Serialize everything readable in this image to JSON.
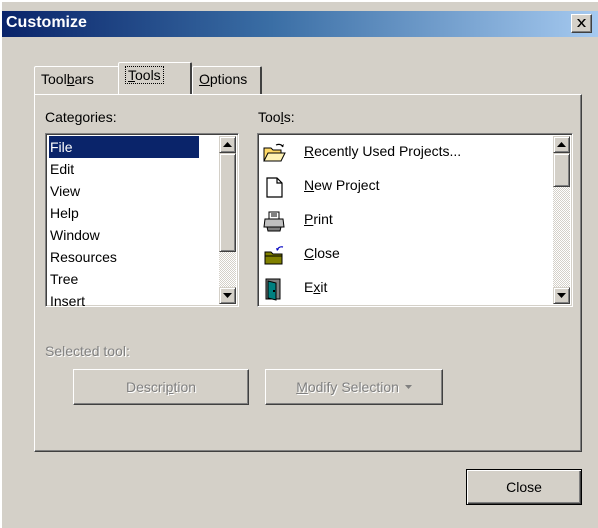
{
  "window": {
    "title": "Customize"
  },
  "tabs": [
    {
      "label": "Toolbars",
      "active": false
    },
    {
      "label": "Tools",
      "active": true
    },
    {
      "label": "Options",
      "active": false
    }
  ],
  "categories": {
    "label": "Categories:",
    "items": [
      "File",
      "Edit",
      "View",
      "Help",
      "Window",
      "Resources",
      "Tree",
      "Insert"
    ],
    "selected": "File"
  },
  "tools": {
    "label": "Tools:",
    "items": [
      {
        "label": "Recently Used Projects...",
        "icon": "open-folder-icon"
      },
      {
        "label": "New Project",
        "icon": "new-document-icon"
      },
      {
        "label": "Print",
        "icon": "printer-icon"
      },
      {
        "label": "Close",
        "icon": "close-folder-icon"
      },
      {
        "label": "Exit",
        "icon": "exit-door-icon"
      }
    ]
  },
  "selected_tool": {
    "label": "Selected tool:"
  },
  "buttons": {
    "description": "Description",
    "modify_selection": "Modify Selection",
    "close": "Close"
  },
  "colors": {
    "dialog_face": "#d4d0c8",
    "title_gradient_start": "#0a246a",
    "title_gradient_end": "#a6caf0",
    "selection": "#0a246a",
    "disabled_text": "#808080"
  }
}
